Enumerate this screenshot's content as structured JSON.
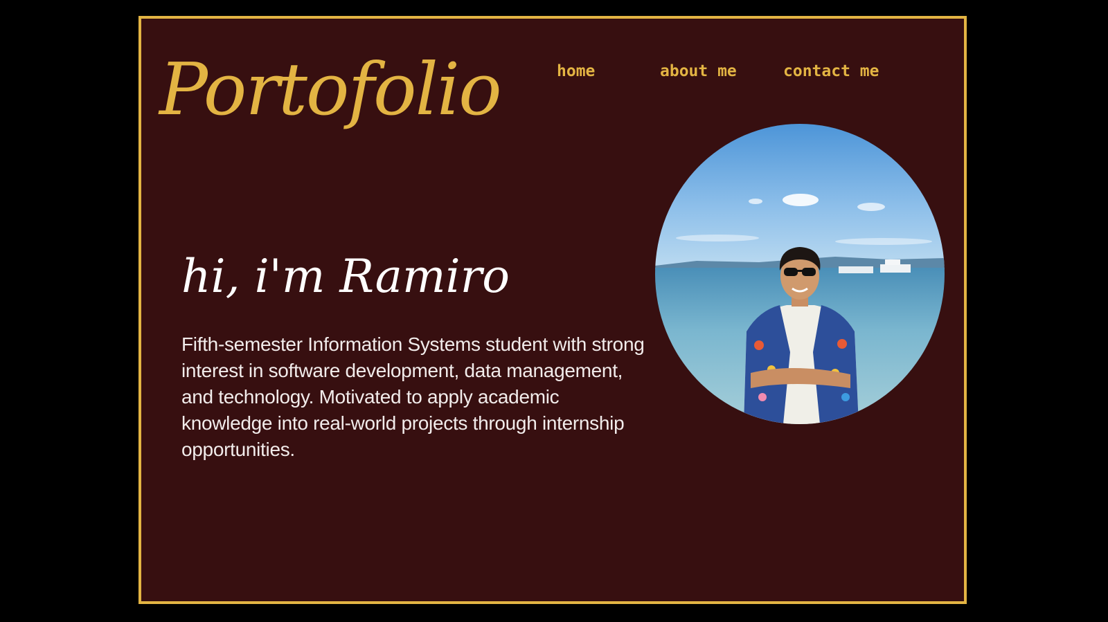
{
  "header": {
    "logo_text": "Portofolio"
  },
  "nav": {
    "items": [
      {
        "label": "home"
      },
      {
        "label": "about me"
      },
      {
        "label": "contact me"
      }
    ]
  },
  "hero": {
    "greeting": "hi, i'm Ramiro",
    "bio": "Fifth-semester Information Systems student with strong interest in software development, data management, and technology. Motivated to apply academic knowledge into real-world projects through internship opportunities."
  },
  "theme": {
    "background": "#370f10",
    "accent": "#e3b443",
    "page_background": "#000000"
  }
}
